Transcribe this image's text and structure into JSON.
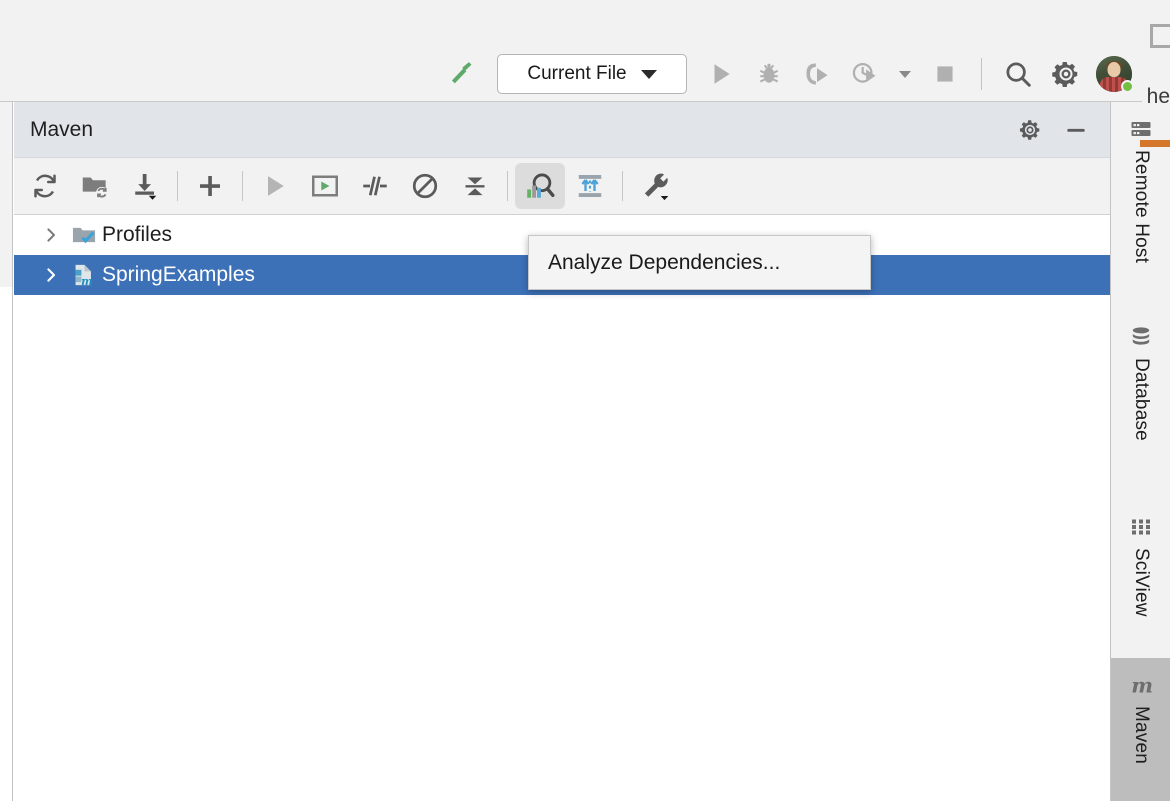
{
  "toolbar": {
    "build_icon": "hammer-icon",
    "run_config": {
      "label": "Current File",
      "icon": "chevron-down-icon"
    },
    "actions": [
      {
        "name": "run-button",
        "icon": "play-icon",
        "enabled": false
      },
      {
        "name": "debug-button",
        "icon": "bug-icon",
        "enabled": false
      },
      {
        "name": "run-with-coverage-button",
        "icon": "coverage-icon",
        "enabled": false
      },
      {
        "name": "profile-button",
        "icon": "profiler-icon",
        "enabled": false
      },
      {
        "name": "more-run-options-button",
        "icon": "chevron-down-icon",
        "enabled": true
      },
      {
        "name": "stop-button",
        "icon": "stop-square-icon",
        "enabled": false
      },
      {
        "name": "search-everywhere-button",
        "icon": "search-icon",
        "enabled": true
      },
      {
        "name": "settings-button",
        "icon": "gear-icon",
        "enabled": true
      }
    ],
    "avatar": {
      "name": "user-avatar",
      "status": "online",
      "status_color": "#73c043"
    }
  },
  "tool_window": {
    "title": "Maven",
    "header_actions": [
      {
        "name": "maven-settings-button",
        "icon": "gear-icon"
      },
      {
        "name": "hide-tool-window-button",
        "icon": "minimize-icon"
      }
    ],
    "toolbar_buttons": [
      {
        "name": "reload-all-maven-projects-button",
        "icon": "refresh-icon",
        "active": false
      },
      {
        "name": "add-maven-projects-button",
        "icon": "folder-refresh-icon",
        "active": false
      },
      {
        "name": "download-sources-and-documentation-button",
        "icon": "download-dropdown-icon",
        "active": false
      },
      {
        "name": "separator",
        "icon": "separator",
        "active": false
      },
      {
        "name": "add-run-configuration-button",
        "icon": "plus-icon",
        "active": false
      },
      {
        "name": "separator",
        "icon": "separator",
        "active": false
      },
      {
        "name": "execute-maven-goal-button",
        "icon": "play-icon",
        "active": false
      },
      {
        "name": "run-configuration-button",
        "icon": "run-window-icon",
        "active": false
      },
      {
        "name": "toggle-skip-tests-button",
        "icon": "skip-tests-icon",
        "active": false
      },
      {
        "name": "toggle-offline-mode-button",
        "icon": "offline-icon",
        "active": false
      },
      {
        "name": "collapse-all-button",
        "icon": "collapse-all-icon",
        "active": false
      },
      {
        "name": "separator",
        "icon": "separator",
        "active": false
      },
      {
        "name": "analyze-dependencies-button",
        "icon": "analyze-dependencies-icon",
        "active": true
      },
      {
        "name": "show-dependencies-button",
        "icon": "show-dependencies-icon",
        "active": false
      },
      {
        "name": "separator",
        "icon": "separator",
        "active": false
      },
      {
        "name": "maven-tools-button",
        "icon": "wrench-dropdown-icon",
        "active": false
      }
    ],
    "tree": [
      {
        "name": "tree-item-profiles",
        "label": "Profiles",
        "icon": "profiles-folder-icon",
        "expanded": false,
        "selected": false
      },
      {
        "name": "tree-item-springexamples",
        "label": "SpringExamples",
        "icon": "maven-module-icon",
        "expanded": false,
        "selected": true
      }
    ]
  },
  "tooltip": {
    "text": "Analyze Dependencies...",
    "visible": true
  },
  "right_sidebar": [
    {
      "name": "sidebar-item-remote-host",
      "label": "Remote Host",
      "icon": "server-icon",
      "selected": false
    },
    {
      "name": "sidebar-item-database",
      "label": "Database",
      "icon": "database-icon",
      "selected": false
    },
    {
      "name": "sidebar-item-sciview",
      "label": "SciView",
      "icon": "grid-icon",
      "selected": false
    },
    {
      "name": "sidebar-item-maven",
      "label": "Maven",
      "icon": "maven-m-icon",
      "selected": true
    }
  ],
  "editor_peek": {
    "text": "he"
  },
  "colors": {
    "selection_blue": "#3c71b8",
    "panel_header": "#e1e5ea",
    "toolbar_bg": "#f2f2f2",
    "accent_orange": "#d4772a",
    "active_button_bg": "#dcdcdc"
  }
}
